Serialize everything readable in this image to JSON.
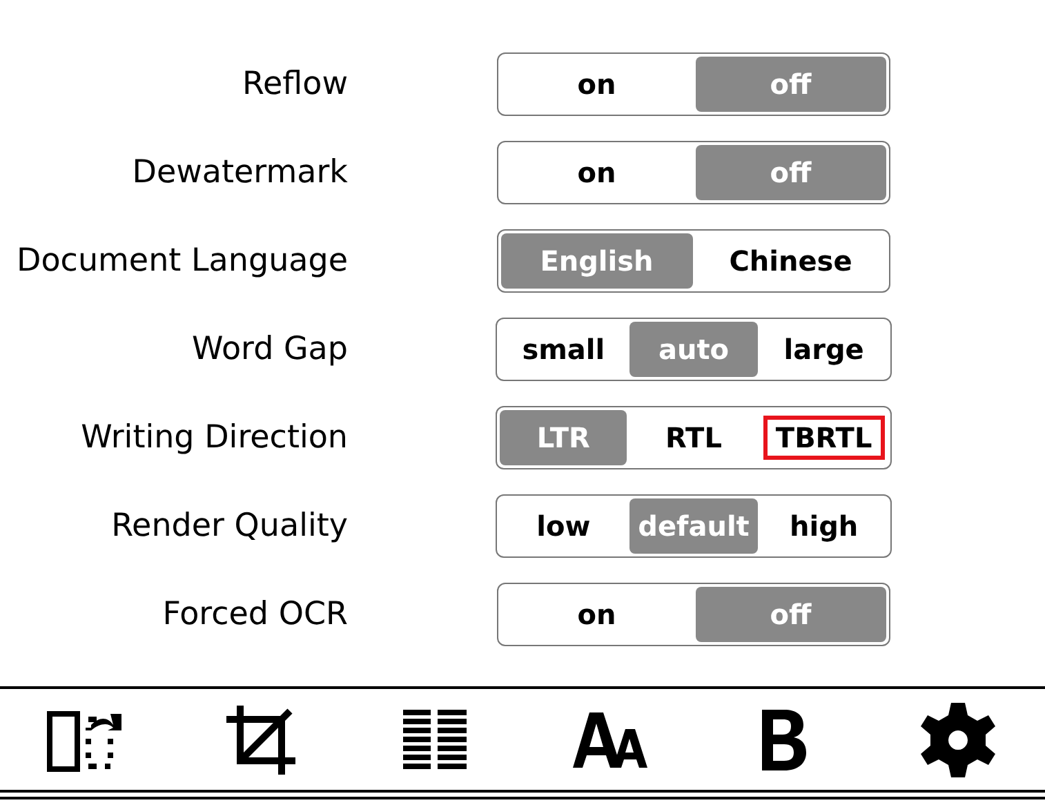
{
  "settings": [
    {
      "label": "Reflow",
      "options": [
        {
          "label": "on",
          "selected": false,
          "highlighted": false
        },
        {
          "label": "off",
          "selected": true,
          "highlighted": false
        }
      ]
    },
    {
      "label": "Dewatermark",
      "options": [
        {
          "label": "on",
          "selected": false,
          "highlighted": false
        },
        {
          "label": "off",
          "selected": true,
          "highlighted": false
        }
      ]
    },
    {
      "label": "Document Language",
      "options": [
        {
          "label": "English",
          "selected": true,
          "highlighted": false
        },
        {
          "label": "Chinese",
          "selected": false,
          "highlighted": false
        }
      ]
    },
    {
      "label": "Word Gap",
      "options": [
        {
          "label": "small",
          "selected": false,
          "highlighted": false
        },
        {
          "label": "auto",
          "selected": true,
          "highlighted": false
        },
        {
          "label": "large",
          "selected": false,
          "highlighted": false
        }
      ]
    },
    {
      "label": "Writing Direction",
      "options": [
        {
          "label": "LTR",
          "selected": true,
          "highlighted": false
        },
        {
          "label": "RTL",
          "selected": false,
          "highlighted": false
        },
        {
          "label": "TBRTL",
          "selected": false,
          "highlighted": true
        }
      ]
    },
    {
      "label": "Render Quality",
      "options": [
        {
          "label": "low",
          "selected": false,
          "highlighted": false
        },
        {
          "label": "default",
          "selected": true,
          "highlighted": false
        },
        {
          "label": "high",
          "selected": false,
          "highlighted": false
        }
      ]
    },
    {
      "label": "Forced OCR",
      "options": [
        {
          "label": "on",
          "selected": false,
          "highlighted": false
        },
        {
          "label": "off",
          "selected": true,
          "highlighted": false
        }
      ]
    }
  ],
  "toolbar": [
    {
      "kind": "page-flip"
    },
    {
      "kind": "crop"
    },
    {
      "kind": "columns"
    },
    {
      "kind": "font-size"
    },
    {
      "kind": "bold"
    },
    {
      "kind": "settings"
    }
  ]
}
